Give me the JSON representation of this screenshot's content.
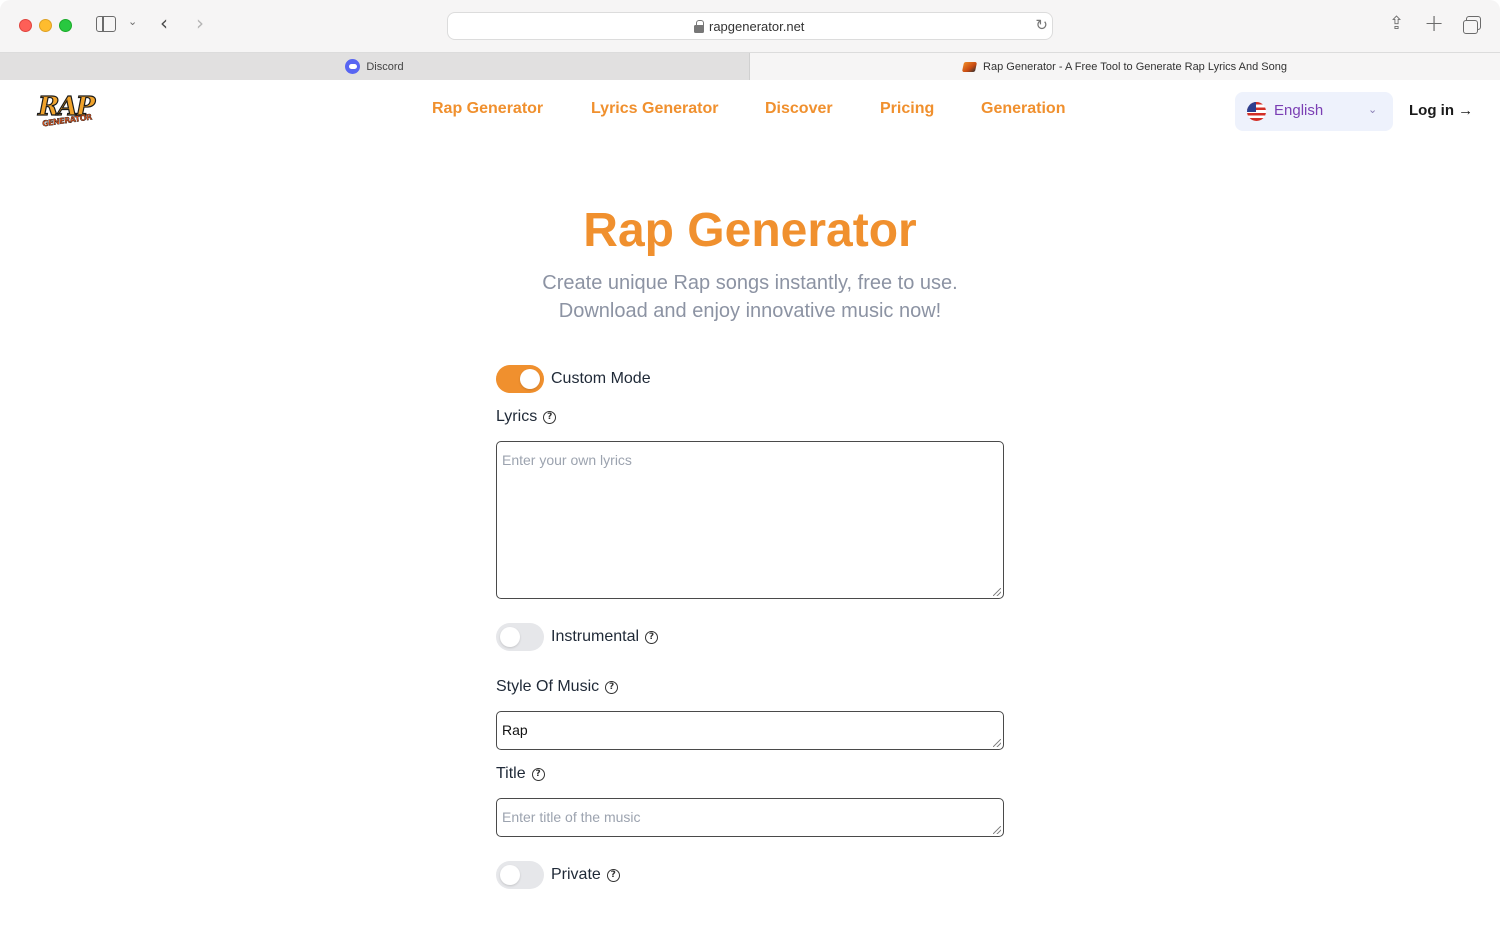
{
  "browser": {
    "url": "rapgenerator.net",
    "tabs": [
      {
        "title": "Discord"
      },
      {
        "title": "Rap Generator - A Free Tool to Generate Rap Lyrics And Song"
      }
    ]
  },
  "header": {
    "logo_text": "RAP",
    "logo_subtext": "GENERATOR",
    "nav": [
      {
        "label": "Rap Generator"
      },
      {
        "label": "Lyrics Generator"
      },
      {
        "label": "Discover"
      },
      {
        "label": "Pricing"
      },
      {
        "label": "Generation"
      }
    ],
    "language": "English",
    "login_label": "Log in →"
  },
  "hero": {
    "title": "Rap Generator",
    "subtitle_line1": "Create unique Rap songs instantly, free to use.",
    "subtitle_line2": "Download and enjoy innovative music now!"
  },
  "form": {
    "custom_mode": {
      "label": "Custom Mode",
      "on": true
    },
    "lyrics": {
      "label": "Lyrics",
      "value": "",
      "placeholder": "Enter your own lyrics"
    },
    "instrumental": {
      "label": "Instrumental",
      "on": false
    },
    "style": {
      "label": "Style Of Music",
      "value": "Rap"
    },
    "title": {
      "label": "Title",
      "value": "",
      "placeholder": "Enter title of the music"
    },
    "private": {
      "label": "Private",
      "on": false
    }
  },
  "colors": {
    "accent": "#f0902e",
    "subtitle": "#8c93a3",
    "language_text": "#7b3fb4"
  }
}
